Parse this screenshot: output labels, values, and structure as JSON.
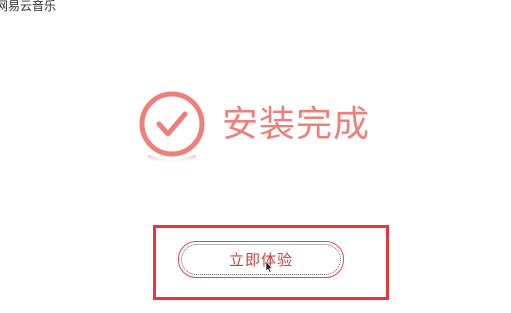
{
  "window": {
    "title": "网易云音乐"
  },
  "main": {
    "icon": "check-circle-icon",
    "message": "安装完成",
    "start_button_label": "立即体验"
  },
  "colors": {
    "accent": "#ef7f7a",
    "button_border": "#e24a4a",
    "button_text": "#c9423f",
    "highlight": "#e8343c"
  }
}
